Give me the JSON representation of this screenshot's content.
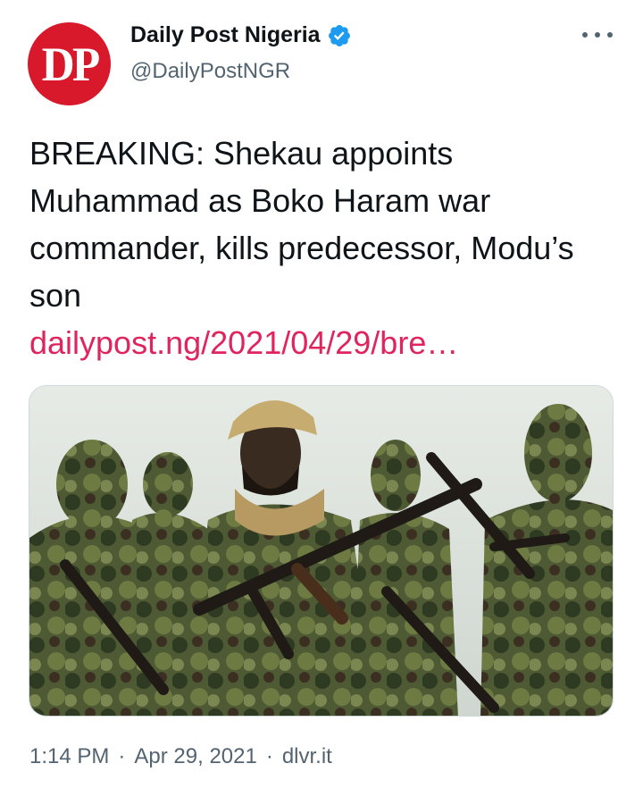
{
  "account": {
    "avatar_text": "DP",
    "name": "Daily Post Nigeria",
    "handle": "@DailyPostNGR",
    "verified_icon": "verified-badge-icon",
    "brand_color": "#d7192b",
    "verified_color": "#1d9bf0"
  },
  "tweet": {
    "text": "BREAKING: Shekau appoints Muhammad as Boko Haram war commander, kills predecessor, Modu’s son",
    "link": "dailypost.ng/2021/04/29/bre…",
    "link_color": "#e0245e"
  },
  "media": {
    "type": "photo"
  },
  "meta": {
    "time": "1:14 PM",
    "separator": "·",
    "date": "Apr 29, 2021",
    "source": "dlvr.it"
  },
  "icons": {
    "more": "more-options-icon"
  }
}
